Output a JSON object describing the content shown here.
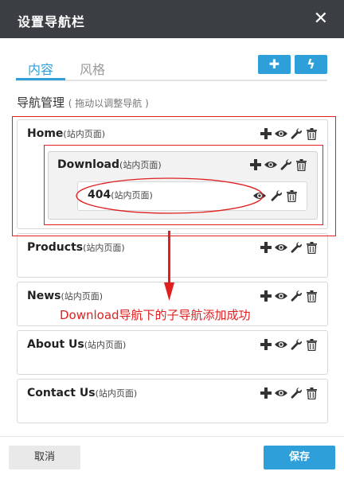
{
  "dialog": {
    "title": "设置导航栏",
    "close_glyph": "✕"
  },
  "tabs": [
    {
      "label": "内容"
    },
    {
      "label": "风格"
    }
  ],
  "toolbar": {
    "add_glyph": "✚",
    "quick_glyph": "ϟ"
  },
  "section": {
    "title": "导航管理",
    "hint": "( 拖动以调整导航 )"
  },
  "nav_items": [
    {
      "name": "Home",
      "type": "(站内页面)"
    },
    {
      "name": "Download",
      "type": "(站内页面)"
    },
    {
      "name": "404",
      "type": "(站内页面)"
    },
    {
      "name": "Products",
      "type": "(站内页面)"
    },
    {
      "name": "News",
      "type": "(站内页面)"
    },
    {
      "name": "About Us",
      "type": "(站内页面)"
    },
    {
      "name": "Contact Us",
      "type": "(站内页面)"
    }
  ],
  "annotation": {
    "text": "Download导航下的子导航添加成功",
    "color": "#e02020"
  },
  "footer": {
    "cancel_label": "取消",
    "save_label": "保存"
  },
  "colors": {
    "accent": "#2e9fd8",
    "titlebar": "#3b3e43",
    "annotation_red": "#e02020"
  },
  "icons": [
    "plus-icon",
    "eye-icon",
    "wrench-icon",
    "trash-icon",
    "close-icon",
    "lightning-icon"
  ]
}
